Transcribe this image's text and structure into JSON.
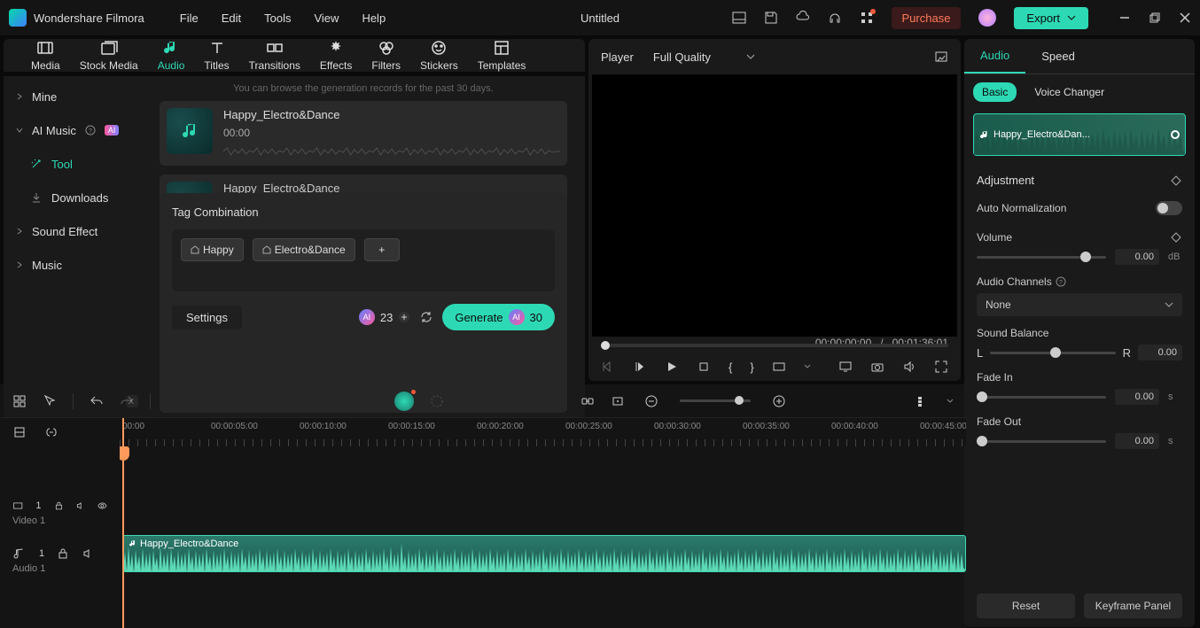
{
  "app": {
    "title": "Wondershare Filmora",
    "doc": "Untitled"
  },
  "menu": [
    "File",
    "Edit",
    "Tools",
    "View",
    "Help"
  ],
  "titlebar": {
    "purchase": "Purchase",
    "export": "Export"
  },
  "mediaTabs": [
    "Media",
    "Stock Media",
    "Audio",
    "Titles",
    "Transitions",
    "Effects",
    "Filters",
    "Stickers",
    "Templates"
  ],
  "mediaTabActive": "Audio",
  "sidebar": {
    "items": [
      {
        "label": "Mine",
        "expandable": true
      },
      {
        "label": "AI Music",
        "expandable": true,
        "ai": true
      },
      {
        "label": "Tool",
        "active": true,
        "indent": true
      },
      {
        "label": "Downloads",
        "indent": true
      },
      {
        "label": "Sound Effect",
        "expandable": true
      },
      {
        "label": "Music",
        "expandable": true
      }
    ]
  },
  "hint": "You can browse the generation records for the past 30 days.",
  "tracks": [
    {
      "name": "Happy_Electro&Dance",
      "dur": "00:00"
    },
    {
      "name": "Happy_Electro&Dance",
      "dur": ""
    }
  ],
  "tagPanel": {
    "title": "Tag Combination",
    "tags": [
      "Happy",
      "Electro&Dance"
    ],
    "settings": "Settings",
    "count": "23",
    "generate": "Generate",
    "genCount": "30"
  },
  "player": {
    "label": "Player",
    "quality": "Full Quality",
    "cur": "00:00:00:00",
    "sep": "/",
    "total": "00:01:36:01"
  },
  "rightPanel": {
    "tabs": [
      "Audio",
      "Speed"
    ],
    "subtabs": [
      "Basic",
      "Voice Changer"
    ],
    "clipName": "Happy_Electro&Dan...",
    "adjustment": "Adjustment",
    "autoNorm": "Auto Normalization",
    "volume": "Volume",
    "volumeVal": "0.00",
    "volumeUnit": "dB",
    "channels": "Audio Channels",
    "channelsVal": "None",
    "balance": "Sound Balance",
    "balL": "L",
    "balR": "R",
    "balVal": "0.00",
    "fadeIn": "Fade In",
    "fadeInVal": "0.00",
    "fadeInUnit": "s",
    "fadeOut": "Fade Out",
    "fadeOutVal": "0.00",
    "fadeOutUnit": "s",
    "reset": "Reset",
    "keyframe": "Keyframe Panel"
  },
  "ruler": [
    "00:00",
    "00:00:05:00",
    "00:00:10:00",
    "00:00:15:00",
    "00:00:20:00",
    "00:00:25:00",
    "00:00:30:00",
    "00:00:35:00",
    "00:00:40:00",
    "00:00:45:00"
  ],
  "tlTracks": {
    "video": {
      "num": "1",
      "label": "Video 1"
    },
    "audio": {
      "num": "1",
      "label": "Audio 1",
      "clipName": "Happy_Electro&Dance"
    }
  }
}
